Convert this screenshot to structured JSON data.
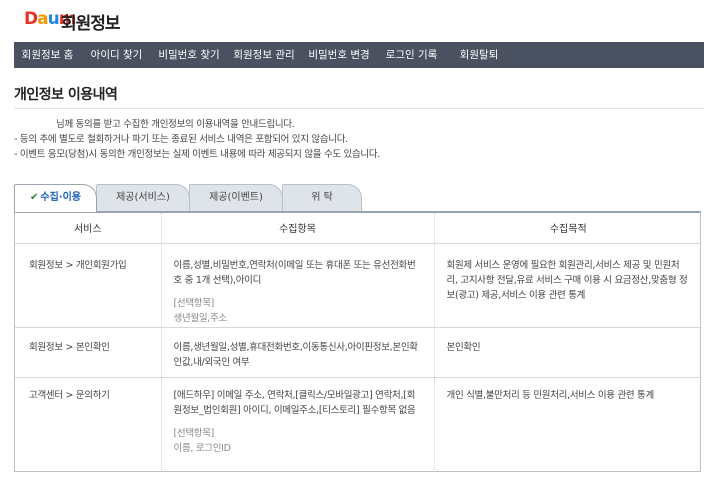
{
  "header": {
    "logo": [
      "D",
      "a",
      "u",
      "m"
    ],
    "title": "회원정보"
  },
  "gnb": [
    {
      "label": "회원정보 홈",
      "width": 67
    },
    {
      "label": "아이디 찾기",
      "width": 71
    },
    {
      "label": "비밀번호 찾기",
      "width": 74
    },
    {
      "label": "회원정보 관리",
      "width": 76
    },
    {
      "label": "비밀번호 변경",
      "width": 74
    },
    {
      "label": "로그인 기록",
      "width": 71
    },
    {
      "label": "회원탈퇴",
      "width": 64
    }
  ],
  "page": {
    "title": "개인정보 이용내역"
  },
  "notice": {
    "line1": "님께 동의를 받고 수집한 개인정보의 이용내역을 안내드립니다.",
    "line2": "- 등의 추에 별도로 철회하거나 파기 또는 종료된 서비스 내역은 포함되어 있지 않습니다.",
    "line3": "- 이벤트 응모(당첨)시 동의한 개인정보는 실제 이벤트 내용에 따라 제공되지 않을 수도 있습니다."
  },
  "tabs": {
    "collect": "수집·이용",
    "service": "제공(서비스)",
    "event": "제공(이벤트)",
    "entrust": "위 탁"
  },
  "table": {
    "headers": {
      "service": "서비스",
      "items": "수집항목",
      "purpose": "수집목적"
    },
    "rows": [
      {
        "service": "회원정보 > 개인회원가입",
        "items": "이름,성별,비밀번호,연락처(이메일 또는 휴대폰 또는 유선전화번호 중 1개 선택),아이디",
        "optional_label": "[선택항목]",
        "optional_items": "생년월일,주소",
        "purpose": "회원제 서비스 운영에 필요한 회원관리,서비스 제공 및 민원처리, 고지사항 전달,유료 서비스 구매 이용 시 요금정산,맞춤형 정보(광고) 제공,서비스 이용 관련 통계"
      },
      {
        "service": "회원정보 > 본인확인",
        "items": "이름,생년월일,성별,휴대전화번호,이동통신사,아이핀정보,본인확인값,내/외국인 여부",
        "purpose": "본인확인"
      },
      {
        "service": "고객센터 > 문의하기",
        "items": "[애드하우] 이메일 주소, 연락처,[클릭스/모바일광고] 연락처,[회원정보_법인회원] 아이디, 이메일주소,[티스토리] 필수항목 없음",
        "optional_label": "[선택항목]",
        "optional_items": "이름, 로그인ID",
        "purpose": "개인 식별,불만처리 등 민원처리,서비스 이용 관련 통계"
      }
    ]
  }
}
